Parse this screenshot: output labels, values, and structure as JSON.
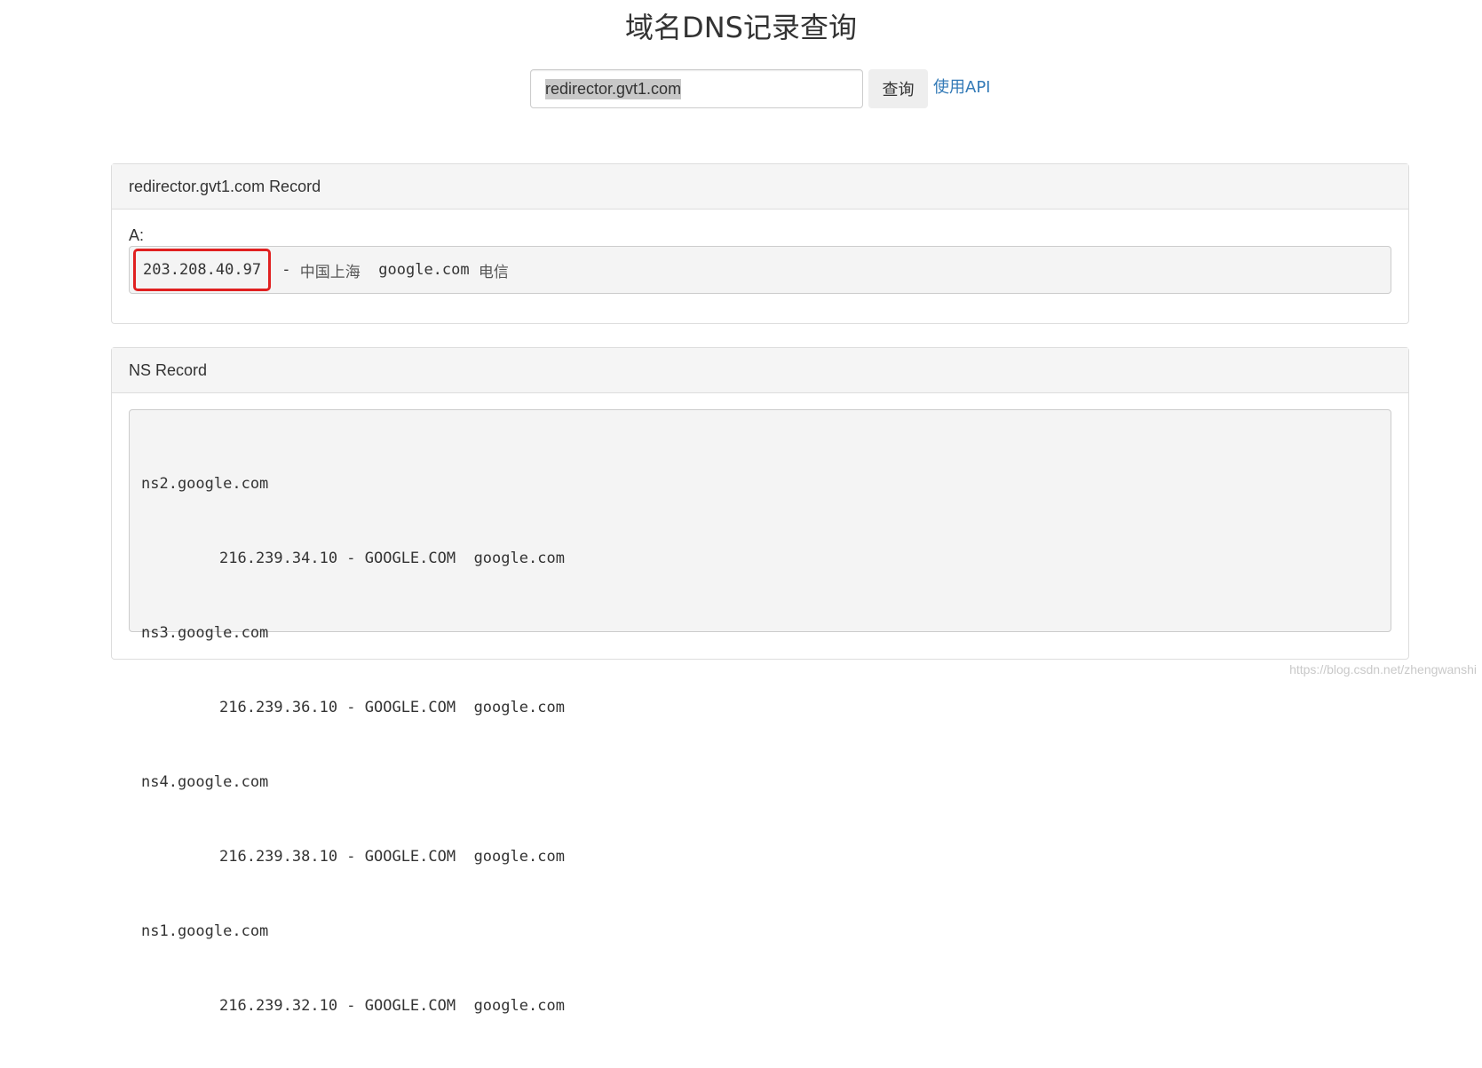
{
  "page": {
    "title": "域名DNS记录查询"
  },
  "search": {
    "value": "redirector.gvt1.com",
    "button_label": "查询",
    "api_link": "使用API"
  },
  "a_panel": {
    "heading": "redirector.gvt1.com Record",
    "label": "A:",
    "ip": "203.208.40.97",
    "separator": " - ",
    "location": "中国上海",
    "org": "google.com",
    "isp": "电信",
    "highlight_color": "#e02020"
  },
  "ns_panel": {
    "heading": "NS Record",
    "records": [
      {
        "host": "ns2.google.com",
        "detail": "216.239.34.10 - GOOGLE.COM  google.com"
      },
      {
        "host": "ns3.google.com",
        "detail": "216.239.36.10 - GOOGLE.COM  google.com"
      },
      {
        "host": "ns4.google.com",
        "detail": "216.239.38.10 - GOOGLE.COM  google.com"
      },
      {
        "host": "ns1.google.com",
        "detail": "216.239.32.10 - GOOGLE.COM  google.com"
      }
    ]
  },
  "watermark": "https://blog.csdn.net/zhengwanshi",
  "colors": {
    "link": "#337ab7",
    "panel_heading_bg": "#f5f5f5",
    "pre_bg": "#f4f4f4"
  }
}
